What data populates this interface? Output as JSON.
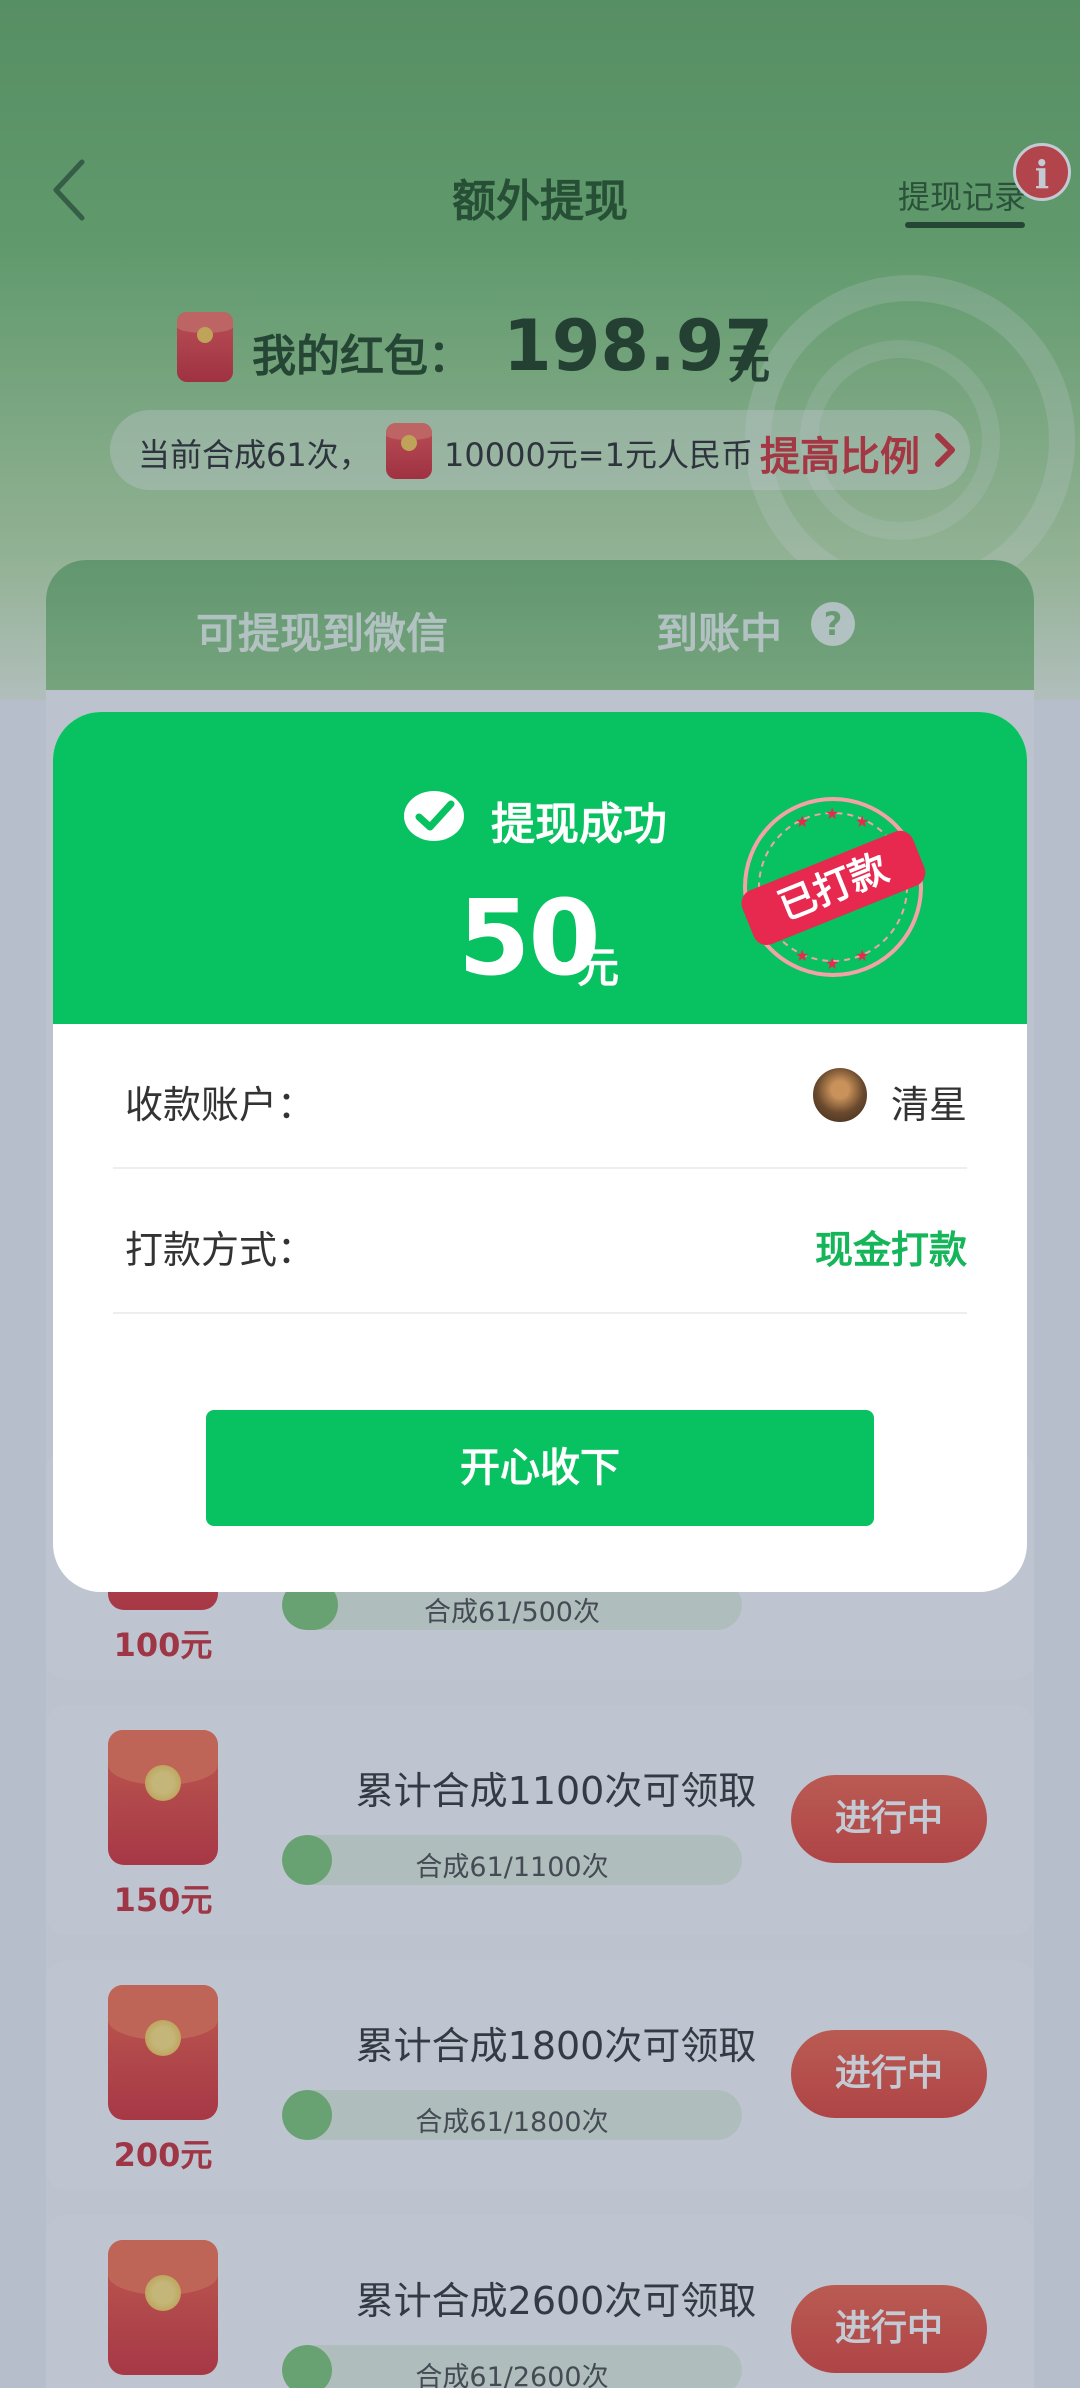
{
  "nav": {
    "title": "额外提现",
    "record_label": "提现记录",
    "info_badge": "i"
  },
  "balance": {
    "label": "我的红包：",
    "amount": "198.97",
    "unit": "元"
  },
  "rate": {
    "prefix": "当前合成61次，",
    "ratio": "10000元=1元人民币",
    "raise_label": "提高比例"
  },
  "tabs": [
    {
      "label": "可提现到微信"
    },
    {
      "label": "到账中"
    }
  ],
  "tasks": [
    {
      "title": "",
      "reward": "100元",
      "progress_text": "合成61/500次",
      "progress": 0.122,
      "button": ""
    },
    {
      "title": "累计合成1100次可领取",
      "reward": "150元",
      "progress_text": "合成61/1100次",
      "progress": 0.055,
      "button": "进行中"
    },
    {
      "title": "累计合成1800次可领取",
      "reward": "200元",
      "progress_text": "合成61/1800次",
      "progress": 0.034,
      "button": "进行中"
    },
    {
      "title": "累计合成2600次可领取",
      "reward": "",
      "progress_text": "合成61/2600次",
      "progress": 0.023,
      "button": "进行中"
    }
  ],
  "modal": {
    "title": "提现成功",
    "amount": "50",
    "unit": "元",
    "stamp_text": "已打款",
    "account_label": "收款账户：",
    "account_name": "清星",
    "method_label": "打款方式：",
    "method_value": "现金打款",
    "confirm_label": "开心收下"
  },
  "colors": {
    "brand_green": "#08c160",
    "hero_green": "#6cb866",
    "red_accent": "#d0272c",
    "stamp_red": "#e8294f"
  },
  "icons": [
    "back-arrow-icon",
    "info-icon",
    "red-packet-icon",
    "chevron-right-icon",
    "help-icon",
    "check-icon",
    "avatar"
  ]
}
